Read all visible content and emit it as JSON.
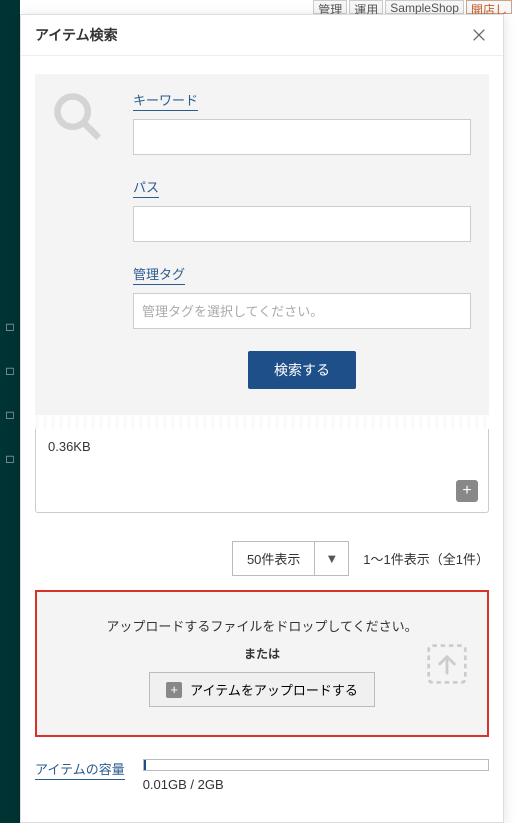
{
  "topbar": {
    "tab_admin": "管理",
    "tab_ops": "運用",
    "shop_name": "SampleShop",
    "open_label": "開店し"
  },
  "modal": {
    "title": "アイテム検索"
  },
  "search": {
    "keyword_label": "キーワード",
    "path_label": "パス",
    "tag_label": "管理タグ",
    "tag_placeholder": "管理タグを選択してください。",
    "search_button": "検索する"
  },
  "item_card": {
    "size_text": "0.36KB"
  },
  "paging": {
    "page_size_label": "50件表示",
    "caret": "▼",
    "range_text": "1〜1件表示（全1件）"
  },
  "upload": {
    "drop_text": "アップロードするファイルをドロップしてください。",
    "or_text": "または",
    "upload_button": "アイテムをアップロードする"
  },
  "capacity": {
    "label": "アイテムの容量",
    "usage_text": "0.01GB / 2GB"
  }
}
